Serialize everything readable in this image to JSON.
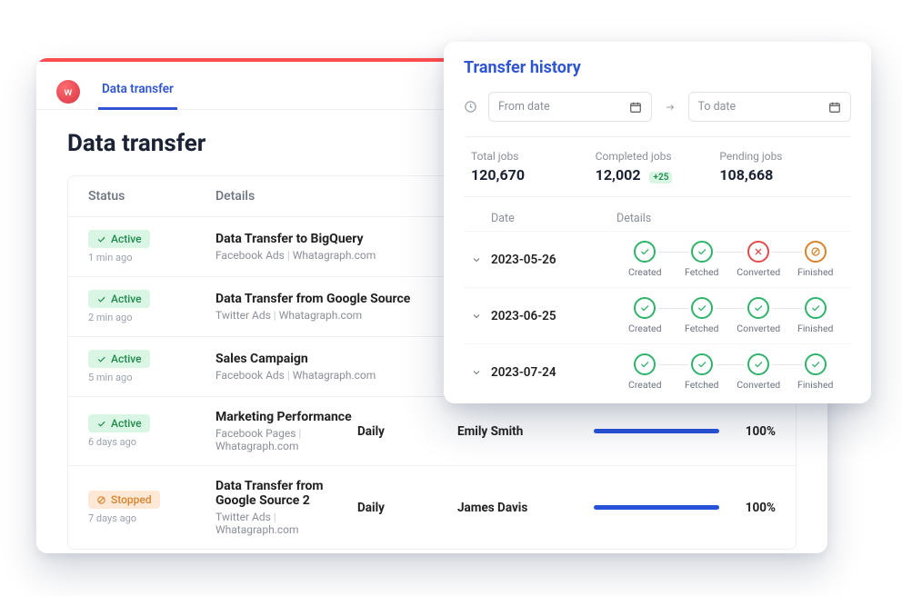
{
  "nav": {
    "tab_label": "Data transfer"
  },
  "page": {
    "title": "Data transfer",
    "headers": {
      "status": "Status",
      "details": "Details"
    }
  },
  "badges": {
    "active": "Active",
    "stopped": "Stopped"
  },
  "rows": [
    {
      "status": "active",
      "time": "1 min ago",
      "title": "Data Transfer to BigQuery",
      "source": "Facebook Ads",
      "account": "Whatagraph.com"
    },
    {
      "status": "active",
      "time": "2 min ago",
      "title": "Data Transfer from Google Source",
      "source": "Twitter Ads",
      "account": "Whatagraph.com"
    },
    {
      "status": "active",
      "time": "5 min ago",
      "title": "Sales Campaign",
      "source": "Facebook Ads",
      "account": "Whatagraph.com"
    },
    {
      "status": "active",
      "time": "6 days ago",
      "title": "Marketing Performance",
      "source": "Facebook Pages",
      "account": "Whatagraph.com",
      "freq": "Daily",
      "owner": "Emily Smith",
      "progress": 100
    },
    {
      "status": "stopped",
      "time": "7 days ago",
      "title": "Data Transfer from Google Source 2",
      "source": "Twitter Ads",
      "account": "Whatagraph.com",
      "freq": "Daily",
      "owner": "James Davis",
      "progress": 100
    }
  ],
  "history": {
    "title": "Transfer history",
    "from_placeholder": "From date",
    "to_placeholder": "To date",
    "stats": {
      "total_label": "Total jobs",
      "total": "120,670",
      "completed_label": "Completed jobs",
      "completed": "12,002",
      "completed_delta": "+25",
      "pending_label": "Pending jobs",
      "pending": "108,668"
    },
    "headers": {
      "date": "Date",
      "details": "Details"
    },
    "step_labels": [
      "Created",
      "Fetched",
      "Converted",
      "Finished"
    ],
    "entries": [
      {
        "date": "2023-05-26",
        "states": [
          "ok",
          "ok",
          "err",
          "block"
        ]
      },
      {
        "date": "2023-06-25",
        "states": [
          "ok",
          "ok",
          "ok",
          "ok"
        ]
      },
      {
        "date": "2023-07-24",
        "states": [
          "ok",
          "ok",
          "ok",
          "ok"
        ]
      }
    ]
  }
}
